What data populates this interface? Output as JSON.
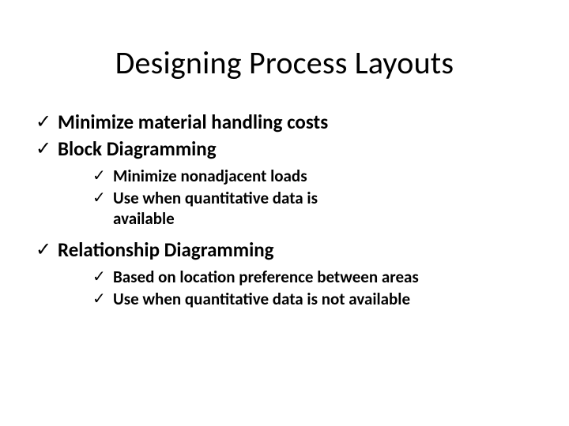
{
  "title": "Designing Process Layouts",
  "items": [
    {
      "label": "Minimize material handling costs",
      "children": []
    },
    {
      "label": "Block Diagramming",
      "children": [
        {
          "label": "Minimize nonadjacent loads"
        },
        {
          "label": "Use when quantitative data is available"
        }
      ]
    },
    {
      "label": "Relationship Diagramming",
      "children": [
        {
          "label": "Based on location preference between areas"
        },
        {
          "label": "Use when quantitative data is not available"
        }
      ]
    }
  ],
  "bullet": "✓"
}
